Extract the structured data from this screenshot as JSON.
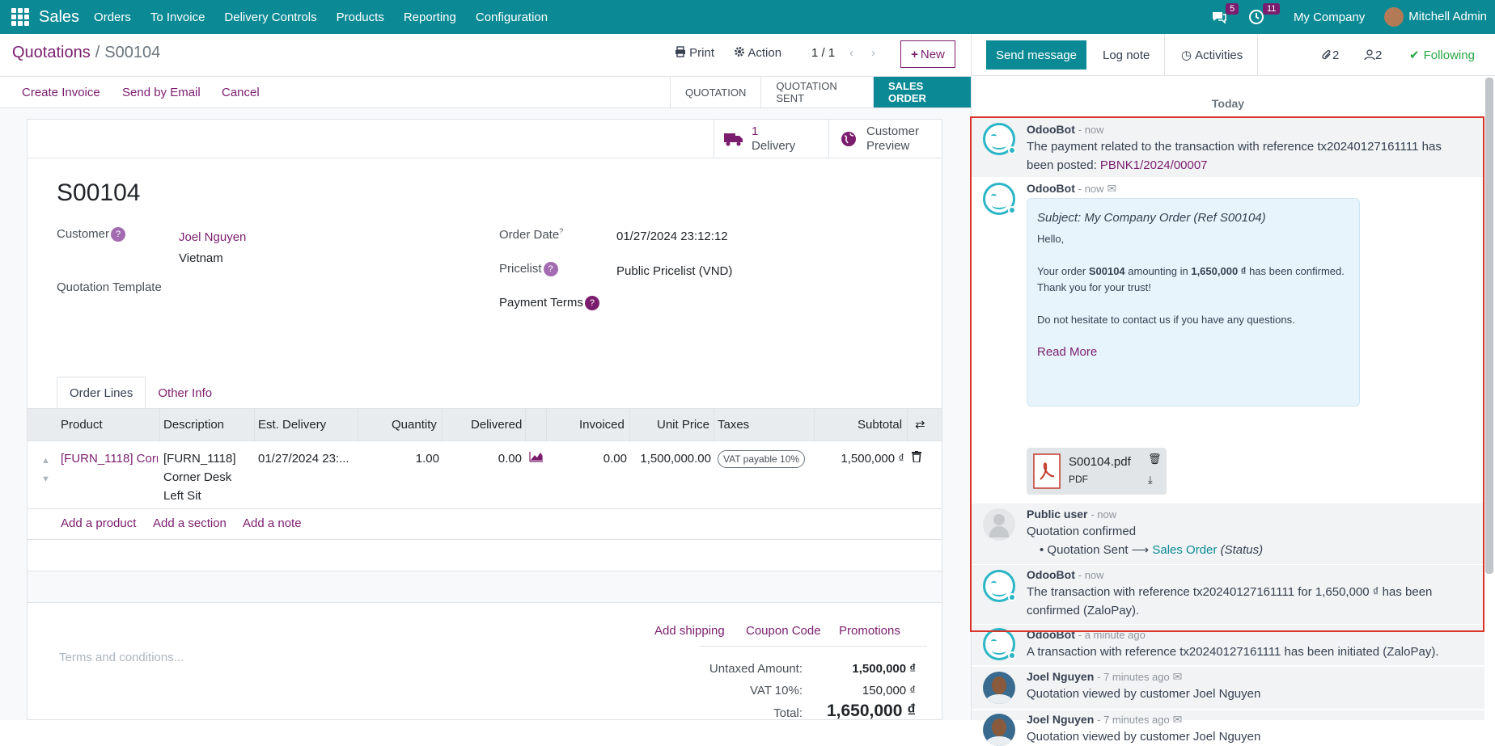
{
  "topbar": {
    "app_name": "Sales",
    "menu": [
      "Orders",
      "To Invoice",
      "Delivery Controls",
      "Products",
      "Reporting",
      "Configuration"
    ],
    "chat_count": "5",
    "activity_count": "11",
    "company": "My Company",
    "user": "Mitchell Admin"
  },
  "breadcrumb": {
    "parent": "Quotations",
    "current": "S00104"
  },
  "toolbar": {
    "print": "Print",
    "action": "Action",
    "pager": "1 / 1",
    "new": "New"
  },
  "actions": {
    "create_invoice": "Create Invoice",
    "send_email": "Send by Email",
    "cancel": "Cancel"
  },
  "statusbar": [
    "QUOTATION",
    "QUOTATION SENT",
    "SALES ORDER"
  ],
  "smart_buttons": {
    "delivery_count": "1",
    "delivery_label": "Delivery",
    "preview_line1": "Customer",
    "preview_line2": "Preview"
  },
  "form": {
    "name": "S00104",
    "customer_label": "Customer",
    "customer_name": "Joel Nguyen",
    "customer_country": "Vietnam",
    "template_label": "Quotation Template",
    "order_date_label": "Order Date",
    "order_date": "01/27/2024 23:12:12",
    "pricelist_label": "Pricelist",
    "pricelist": "Public Pricelist (VND)",
    "payment_terms_label": "Payment Terms",
    "help": "?"
  },
  "tabs": [
    "Order Lines",
    "Other Info"
  ],
  "table": {
    "headers": [
      "Product",
      "Description",
      "Est. Delivery",
      "Quantity",
      "Delivered",
      "Invoiced",
      "Unit Price",
      "Taxes",
      "Subtotal"
    ],
    "row": {
      "product": "[FURN_1118] Corr",
      "description": [
        "[FURN_1118]",
        "Corner Desk",
        "Left Sit"
      ],
      "est_delivery": "01/27/2024 23:...",
      "quantity": "1.00",
      "delivered": "0.00",
      "invoiced": "0.00",
      "unit_price": "1,500,000.00",
      "tax": "VAT payable 10%",
      "subtotal": "1,500,000 ₫"
    },
    "add_links": [
      "Add a product",
      "Add a section",
      "Add a note"
    ]
  },
  "footer": {
    "links": [
      "Add shipping",
      "Coupon Code",
      "Promotions"
    ],
    "terms_placeholder": "Terms and conditions...",
    "untaxed_label": "Untaxed Amount:",
    "untaxed": "1,500,000 ₫",
    "vat_label": "VAT 10%:",
    "vat": "150,000 ₫",
    "total_label": "Total:",
    "total": "1,650,000 ₫"
  },
  "chatter": {
    "send_message": "Send message",
    "log_note": "Log note",
    "activities": "Activities",
    "attachments": "2",
    "followers": "2",
    "following": "Following",
    "today": "Today",
    "messages": [
      {
        "author": "OdooBot",
        "date": "- now",
        "text": "The payment related to the transaction with reference tx20240127161111 has been posted:",
        "link": "PBNK1/2024/00007"
      },
      {
        "author": "OdooBot",
        "date": "- now",
        "subject": "Subject: My Company Order (Ref S00104)",
        "hello": "Hello,",
        "line1_a": "Your order ",
        "line1_b": "S00104",
        "line1_c": " amounting in ",
        "line1_d": "1,650,000 ₫",
        "line1_e": " has been confirmed.",
        "line2": "Thank you for your trust!",
        "line3": "Do not hesitate to contact us if you have any questions.",
        "read_more": "Read More",
        "file_name": "S00104.pdf",
        "file_type": "PDF"
      },
      {
        "author": "Public user",
        "date": "- now",
        "text": "Quotation confirmed",
        "from": "Quotation Sent",
        "to": "Sales Order",
        "field": "(Status)"
      },
      {
        "author": "OdooBot",
        "date": "- now",
        "text": "The transaction with reference tx20240127161111 for 1,650,000 ₫ has been confirmed (ZaloPay)."
      },
      {
        "author": "OdooBot",
        "date": "- a minute ago",
        "text": "A transaction with reference tx20240127161111 has been initiated (ZaloPay)."
      },
      {
        "author": "Joel Nguyen",
        "date": "- 7 minutes ago",
        "text": "Quotation viewed by customer Joel Nguyen"
      },
      {
        "author": "Joel Nguyen",
        "date": "- 7 minutes ago",
        "text": "Quotation viewed by customer Joel Nguyen"
      }
    ]
  },
  "colors": {
    "brand": "#0b8a95",
    "accent": "#7b1d6e",
    "highlight_box": "#d9342b"
  }
}
